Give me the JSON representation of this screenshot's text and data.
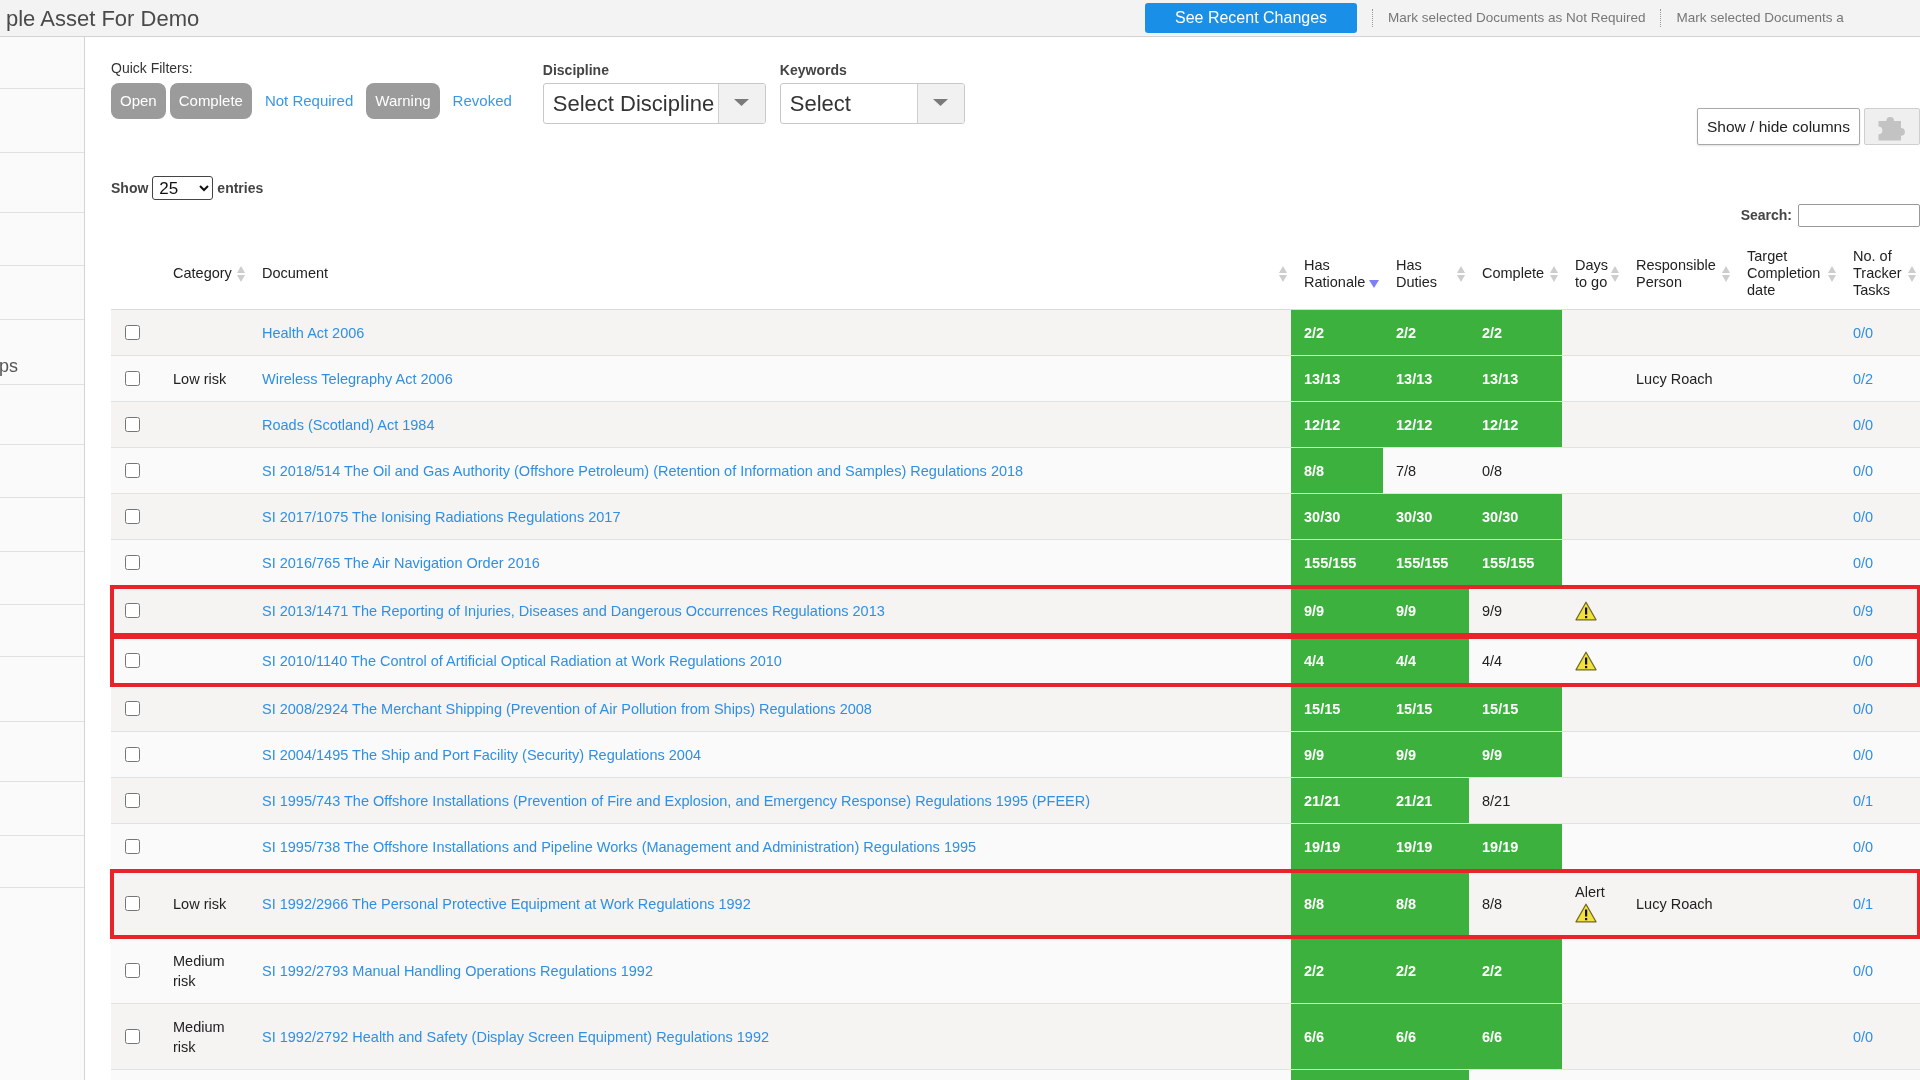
{
  "header": {
    "title": "ple Asset For Demo",
    "primary_button": "See Recent Changes",
    "actions": [
      "Mark selected Documents as Not Required",
      "Mark selected Documents a"
    ]
  },
  "sidebar": {
    "items": [
      {
        "label": "ps"
      }
    ]
  },
  "quick_filters": {
    "label": "Quick Filters:",
    "filters": [
      {
        "label": "Open",
        "selected": true
      },
      {
        "label": "Complete",
        "selected": true
      },
      {
        "label": "Not Required",
        "selected": false
      },
      {
        "label": "Warning",
        "selected": true
      },
      {
        "label": "Revoked",
        "selected": false
      }
    ]
  },
  "discipline": {
    "label": "Discipline",
    "value": "Select Discipline"
  },
  "keywords": {
    "label": "Keywords",
    "value": "Select"
  },
  "column_toggle": {
    "label": "Show / hide columns"
  },
  "length_menu": {
    "prefix": "Show",
    "value": "25",
    "suffix": "entries"
  },
  "search": {
    "label": "Search:"
  },
  "table": {
    "columns": [
      {
        "label": "Category",
        "sorted": false
      },
      {
        "label": "Document",
        "sorted": false
      },
      {
        "label": "Has Rationale",
        "sorted": true
      },
      {
        "label": "Has Duties",
        "sorted": false
      },
      {
        "label": "Complete",
        "sorted": false
      },
      {
        "label": "Days to go",
        "sorted": false
      },
      {
        "label": "Responsible Person",
        "sorted": false
      },
      {
        "label": "Target Completion date",
        "sorted": false
      },
      {
        "label": "No. of Tracker Tasks",
        "sorted": false
      }
    ],
    "rows": [
      {
        "checked": false,
        "highlighted": false,
        "warning": false,
        "document": "Health Act 2006",
        "rationale": {
          "value": "2/2",
          "met": true
        },
        "duties": {
          "value": "2/2",
          "met": true
        },
        "complete": {
          "value": "2/2",
          "met": true
        },
        "tracker_tasks": "0/0"
      },
      {
        "checked": false,
        "highlighted": false,
        "warning": false,
        "category": "Low risk",
        "document": "Wireless Telegraphy Act 2006",
        "rationale": {
          "value": "13/13",
          "met": true
        },
        "duties": {
          "value": "13/13",
          "met": true
        },
        "complete": {
          "value": "13/13",
          "met": true
        },
        "responsible": "Lucy Roach",
        "tracker_tasks": "0/2"
      },
      {
        "checked": false,
        "highlighted": false,
        "warning": false,
        "document": "Roads (Scotland) Act 1984",
        "rationale": {
          "value": "12/12",
          "met": true
        },
        "duties": {
          "value": "12/12",
          "met": true
        },
        "complete": {
          "value": "12/12",
          "met": true
        },
        "tracker_tasks": "0/0"
      },
      {
        "checked": false,
        "highlighted": false,
        "warning": false,
        "document": "SI 2018/514 The Oil and Gas Authority (Offshore Petroleum) (Retention of Information and Samples) Regulations 2018",
        "rationale": {
          "value": "8/8",
          "met": true
        },
        "duties": {
          "value": "7/8",
          "met": false
        },
        "complete": {
          "value": "0/8",
          "met": false
        },
        "tracker_tasks": "0/0"
      },
      {
        "checked": false,
        "highlighted": false,
        "warning": false,
        "document": "SI 2017/1075 The Ionising Radiations Regulations 2017",
        "rationale": {
          "value": "30/30",
          "met": true
        },
        "duties": {
          "value": "30/30",
          "met": true
        },
        "complete": {
          "value": "30/30",
          "met": true
        },
        "tracker_tasks": "0/0"
      },
      {
        "checked": false,
        "highlighted": false,
        "warning": false,
        "document": "SI 2016/765 The Air Navigation Order 2016",
        "rationale": {
          "value": "155/155",
          "met": true
        },
        "duties": {
          "value": "155/155",
          "met": true
        },
        "complete": {
          "value": "155/155",
          "met": true
        },
        "tracker_tasks": "0/0"
      },
      {
        "checked": false,
        "highlighted": true,
        "warning": true,
        "document": "SI 2013/1471 The Reporting of Injuries, Diseases and Dangerous Occurrences Regulations 2013",
        "rationale": {
          "value": "9/9",
          "met": true
        },
        "duties": {
          "value": "9/9",
          "met": true
        },
        "complete": {
          "value": "9/9",
          "met": false
        },
        "tracker_tasks": "0/9"
      },
      {
        "checked": false,
        "highlighted": true,
        "warning": true,
        "document": "SI 2010/1140 The Control of Artificial Optical Radiation at Work Regulations 2010",
        "rationale": {
          "value": "4/4",
          "met": true
        },
        "duties": {
          "value": "4/4",
          "met": true
        },
        "complete": {
          "value": "4/4",
          "met": false
        },
        "tracker_tasks": "0/0"
      },
      {
        "checked": false,
        "highlighted": false,
        "warning": false,
        "document": "SI 2008/2924 The Merchant Shipping (Prevention of Air Pollution from Ships) Regulations 2008",
        "rationale": {
          "value": "15/15",
          "met": true
        },
        "duties": {
          "value": "15/15",
          "met": true
        },
        "complete": {
          "value": "15/15",
          "met": true
        },
        "tracker_tasks": "0/0"
      },
      {
        "checked": false,
        "highlighted": false,
        "warning": false,
        "document": "SI 2004/1495 The Ship and Port Facility (Security) Regulations 2004",
        "rationale": {
          "value": "9/9",
          "met": true
        },
        "duties": {
          "value": "9/9",
          "met": true
        },
        "complete": {
          "value": "9/9",
          "met": true
        },
        "tracker_tasks": "0/0"
      },
      {
        "checked": false,
        "highlighted": false,
        "warning": false,
        "document": "SI 1995/743 The Offshore Installations (Prevention of Fire and Explosion, and Emergency Response) Regulations 1995 (PFEER)",
        "rationale": {
          "value": "21/21",
          "met": true
        },
        "duties": {
          "value": "21/21",
          "met": true
        },
        "complete": {
          "value": "8/21",
          "met": false
        },
        "tracker_tasks": "0/1"
      },
      {
        "checked": false,
        "highlighted": false,
        "warning": false,
        "document": "SI 1995/738 The Offshore Installations and Pipeline Works (Management and Administration) Regulations 1995",
        "rationale": {
          "value": "19/19",
          "met": true
        },
        "duties": {
          "value": "19/19",
          "met": true
        },
        "complete": {
          "value": "19/19",
          "met": true
        },
        "tracker_tasks": "0/0"
      },
      {
        "checked": false,
        "highlighted": true,
        "warning": true,
        "category": "Low risk",
        "document": "SI 1992/2966 The Personal Protective Equipment at Work Regulations 1992",
        "rationale": {
          "value": "8/8",
          "met": true
        },
        "duties": {
          "value": "8/8",
          "met": true
        },
        "complete": {
          "value": "8/8",
          "met": false
        },
        "days_to_go": "Alert",
        "responsible": "Lucy Roach",
        "tracker_tasks": "0/1"
      },
      {
        "checked": false,
        "highlighted": false,
        "warning": false,
        "category": "Medium risk",
        "document": "SI 1992/2793 Manual Handling Operations Regulations 1992",
        "rationale": {
          "value": "2/2",
          "met": true
        },
        "duties": {
          "value": "2/2",
          "met": true
        },
        "complete": {
          "value": "2/2",
          "met": true
        },
        "tracker_tasks": "0/0"
      },
      {
        "checked": false,
        "highlighted": false,
        "warning": false,
        "category": "Medium risk",
        "document": "SI 1992/2792 Health and Safety (Display Screen Equipment) Regulations 1992",
        "rationale": {
          "value": "6/6",
          "met": true
        },
        "duties": {
          "value": "6/6",
          "met": true
        },
        "complete": {
          "value": "6/6",
          "met": true
        },
        "tracker_tasks": "0/0"
      }
    ],
    "partial_row": {
      "rationale": {
        "met": true
      },
      "duties": {
        "met": true
      },
      "complete": {
        "met": false
      }
    }
  }
}
